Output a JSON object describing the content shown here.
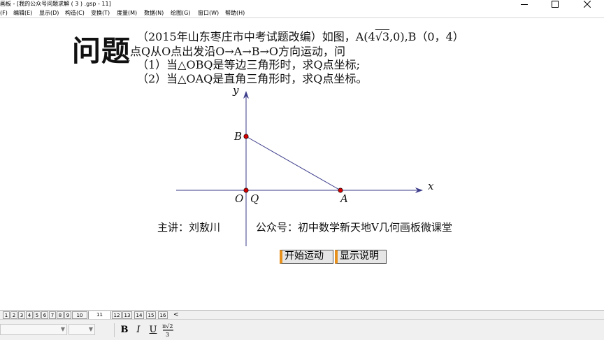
{
  "window": {
    "title": "画板 - [我的公众号问题求解 ( 3 ) .gsp - 11]"
  },
  "menu": {
    "items": [
      {
        "label": "(F)"
      },
      {
        "label": "编辑(E)"
      },
      {
        "label": "显示(D)"
      },
      {
        "label": "构造(C)"
      },
      {
        "label": "变换(T)"
      },
      {
        "label": "度量(M)"
      },
      {
        "label": "数据(N)"
      },
      {
        "label": "绘图(G)"
      },
      {
        "label": "窗口(W)"
      },
      {
        "label": "帮助(H)"
      }
    ]
  },
  "problem": {
    "heading": "问题",
    "line1": "（2015年山东枣庄市中考试题改编）如图，A(4",
    "line1_sqrt": "√3",
    "line1_rest": ",0),B（0，4）",
    "line2": "点Q从O点出发沿O→A→B→O方向运动，问",
    "line3": "（1）当△OBQ是等边三角形时，求Q点坐标;",
    "line4": "（2）当△OAQ是直角三角形时，求Q点坐标。"
  },
  "figure": {
    "x_axis_label": "x",
    "y_axis_label": "y",
    "points": [
      {
        "name": "O",
        "label": "O"
      },
      {
        "name": "Q",
        "label": "Q"
      },
      {
        "name": "A",
        "label": "A"
      },
      {
        "name": "B",
        "label": "B"
      }
    ],
    "point_color": "#d40000"
  },
  "footer": {
    "credit": "主讲：刘敖川",
    "account": "公众号：初中数学新天地V几何画板微课堂"
  },
  "buttons": {
    "start": "开始运动",
    "info": "显示说明"
  },
  "accent_color": "#e8901c",
  "page_tabs": {
    "tabs": [
      "1",
      "2",
      "3",
      "4",
      "5",
      "6",
      "7",
      "8",
      "9",
      "10",
      "11",
      "12",
      "13",
      "14",
      "15",
      "16"
    ],
    "active": "11",
    "scroll": "<"
  },
  "text_toolbar": {
    "bold": "B",
    "italic": "I",
    "underline": "U",
    "math_top": "π√2",
    "math_bottom": "3"
  }
}
